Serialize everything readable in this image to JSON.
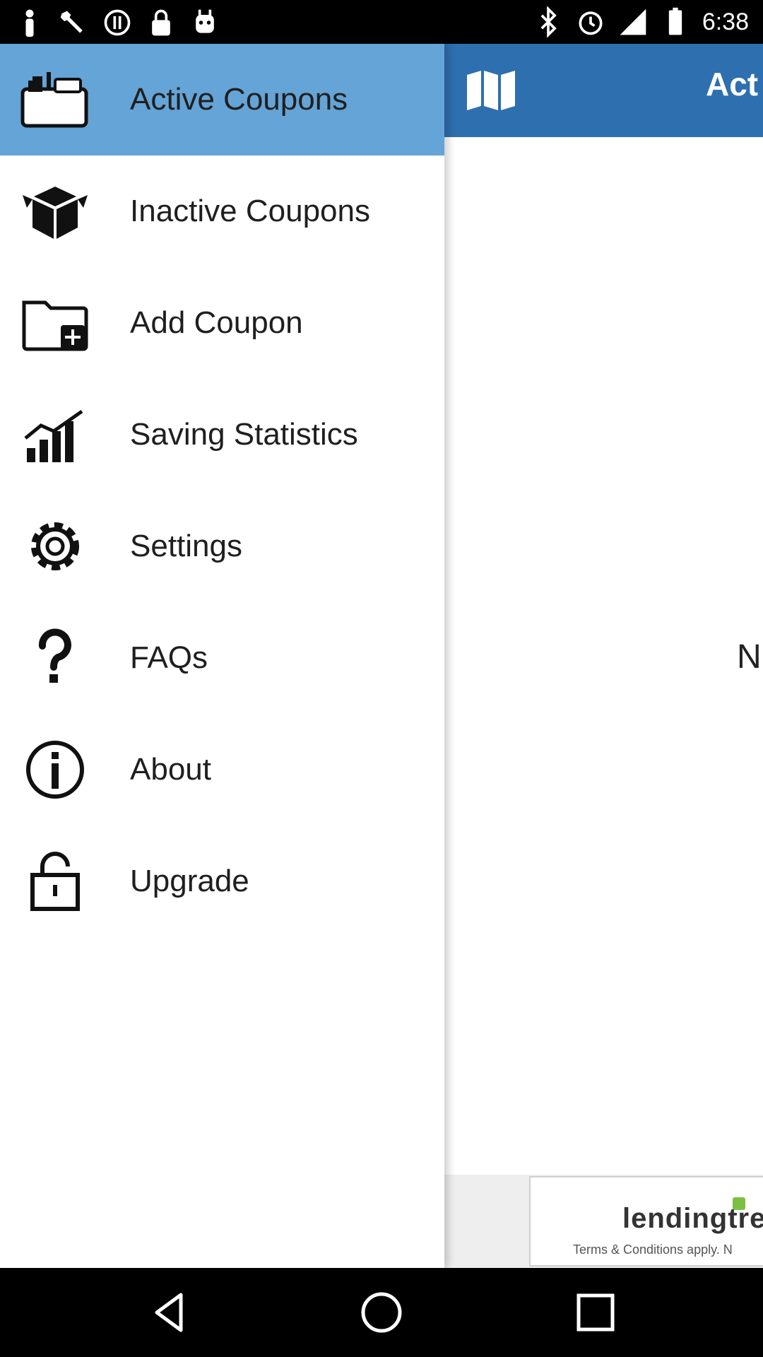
{
  "status_bar": {
    "time": "6:38",
    "left_icons": [
      "person-icon",
      "wrench-icon",
      "sync-icon",
      "lock-icon",
      "android-icon"
    ],
    "right_icons": [
      "bluetooth-icon",
      "alarm-icon",
      "signal-icon",
      "battery-icon"
    ]
  },
  "app": {
    "title": "Act",
    "content_text": "N",
    "ad": {
      "logo_text": "lendingtre",
      "terms_text": "Terms & Conditions apply. N"
    },
    "header_color": "#2e6faf"
  },
  "drawer": {
    "active_color": "#64a4d6",
    "items": [
      {
        "label": "Active Coupons",
        "icon": "folder-coupons-icon",
        "active": true
      },
      {
        "label": "Inactive Coupons",
        "icon": "open-box-icon",
        "active": false
      },
      {
        "label": "Add Coupon",
        "icon": "folder-add-icon",
        "active": false
      },
      {
        "label": "Saving Statistics",
        "icon": "bar-chart-icon",
        "active": false
      },
      {
        "label": "Settings",
        "icon": "gear-icon",
        "active": false
      },
      {
        "label": "FAQs",
        "icon": "question-icon",
        "active": false
      },
      {
        "label": "About",
        "icon": "info-icon",
        "active": false
      },
      {
        "label": "Upgrade",
        "icon": "unlock-icon",
        "active": false
      }
    ]
  },
  "nav_bar": {
    "buttons": [
      "back-icon",
      "home-icon",
      "recents-icon"
    ]
  }
}
